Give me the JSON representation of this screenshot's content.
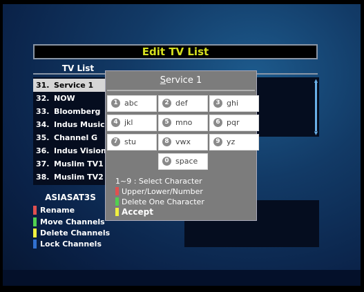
{
  "window": {
    "title": "Edit TV List"
  },
  "list": {
    "header": "TV List",
    "rows": [
      {
        "num": "31.",
        "name": "Service 1",
        "selected": true
      },
      {
        "num": "32.",
        "name": "NOW"
      },
      {
        "num": "33.",
        "name": "Bloomberg"
      },
      {
        "num": "34.",
        "name": "Indus Music"
      },
      {
        "num": "35.",
        "name": "Channel G"
      },
      {
        "num": "36.",
        "name": "Indus Vision"
      },
      {
        "num": "37.",
        "name": "Muslim TV1"
      },
      {
        "num": "38.",
        "name": "Muslim TV2"
      }
    ]
  },
  "satellite": {
    "name": "ASIASAT3S"
  },
  "legend": [
    {
      "label": "Rename",
      "color": "#e05050",
      "icon": "red-key-icon"
    },
    {
      "label": "Move Channels",
      "color": "#50d050",
      "icon": "green-key-icon"
    },
    {
      "label": "Delete Channels",
      "color": "#f0f040",
      "icon": "yellow-key-icon"
    },
    {
      "label": "Lock Channels",
      "color": "#3070d0",
      "icon": "blue-key-icon"
    }
  ],
  "popup": {
    "title_prefix": "S",
    "title_rest": "ervice 1",
    "keys": [
      {
        "num": "1",
        "label": "abc"
      },
      {
        "num": "2",
        "label": "def"
      },
      {
        "num": "3",
        "label": "ghi"
      },
      {
        "num": "4",
        "label": "jkl"
      },
      {
        "num": "5",
        "label": "mno"
      },
      {
        "num": "6",
        "label": "pqr"
      },
      {
        "num": "7",
        "label": "stu"
      },
      {
        "num": "8",
        "label": "vwx"
      },
      {
        "num": "9",
        "label": "yz"
      },
      {
        "num": "0",
        "label": "space"
      }
    ],
    "hints": [
      {
        "label": "1~9 : Select Character",
        "color": ""
      },
      {
        "label": "Upper/Lower/Number",
        "color": "#e05050"
      },
      {
        "label": "Delete One Character",
        "color": "#50d050"
      },
      {
        "label": "Accept",
        "color": "#f0f040"
      }
    ]
  }
}
